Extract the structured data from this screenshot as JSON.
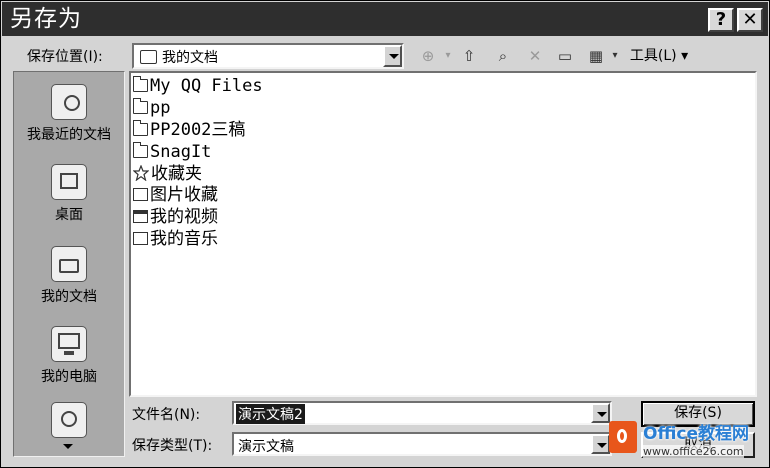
{
  "window": {
    "title": "另存为",
    "help_label": "?",
    "close_label": "✕"
  },
  "location": {
    "label": "保存位置(I):",
    "value": "我的文档"
  },
  "toolbar": {
    "back_label": "⊕",
    "up_label": "⇧",
    "search_label": "⌕",
    "delete_label": "✕",
    "newfolder_label": "▭",
    "views_label": "▦",
    "tools_label": "工具(L) ▾"
  },
  "places": [
    {
      "label": "我最近的文档",
      "icon": "recent-documents-icon"
    },
    {
      "label": "桌面",
      "icon": "desktop-icon"
    },
    {
      "label": "我的文档",
      "icon": "my-documents-icon"
    },
    {
      "label": "我的电脑",
      "icon": "my-computer-icon"
    },
    {
      "label": "",
      "icon": "network-places-icon"
    }
  ],
  "files": [
    {
      "name": "My QQ Files",
      "icon": "folder-icon"
    },
    {
      "name": "pp",
      "icon": "folder-icon"
    },
    {
      "name": "PP2002三稿",
      "icon": "folder-icon"
    },
    {
      "name": "SnagIt",
      "icon": "folder-icon"
    },
    {
      "name": "收藏夹",
      "icon": "favorites-star-icon"
    },
    {
      "name": "图片收藏",
      "icon": "pictures-folder-icon"
    },
    {
      "name": "我的视频",
      "icon": "video-folder-icon"
    },
    {
      "name": "我的音乐",
      "icon": "music-folder-icon"
    }
  ],
  "filename": {
    "label": "文件名(N):",
    "value": "演示文稿2"
  },
  "filetype": {
    "label": "保存类型(T):",
    "value": "演示文稿"
  },
  "buttons": {
    "save": "保存(S)",
    "cancel": "取消"
  },
  "watermark": {
    "brand": "Office教程网",
    "url": "www.office26.com"
  },
  "colors": {
    "titlebar": "#2e2e2e",
    "dialog": "#d4d4d4",
    "places_bar": "#a9a9a9",
    "selection": "#1a1a1a",
    "watermark_orange": "#e8561b",
    "watermark_blue": "#2a7fd4"
  }
}
